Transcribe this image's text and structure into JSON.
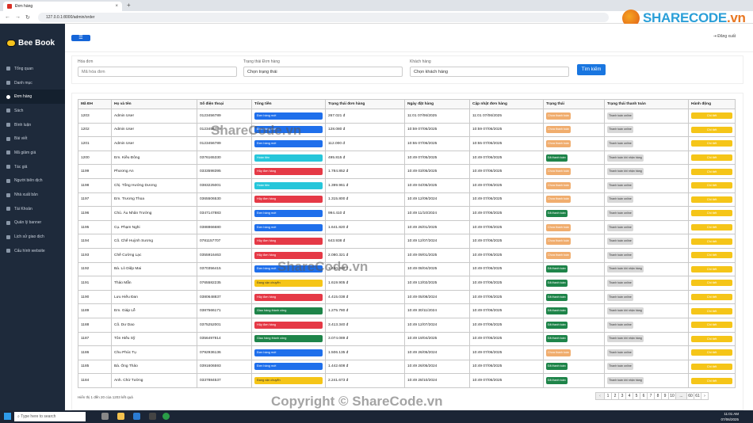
{
  "browser": {
    "tab_title": "Đơn hàng",
    "url": "127.0.0.1:8000/admin/order"
  },
  "watermark": {
    "brand": "SHARECODE",
    "brand_suffix": ".vn",
    "center": "ShareCode.vn",
    "copyright": "Copyright © ShareCode.vn"
  },
  "sidebar": {
    "logo": "Bee Book",
    "items": [
      {
        "label": "Tổng quan",
        "active": false
      },
      {
        "label": "Danh mục",
        "active": false
      },
      {
        "label": "Đơn hàng",
        "active": true
      },
      {
        "label": "Sách",
        "active": false
      },
      {
        "label": "Bình luận",
        "active": false
      },
      {
        "label": "Bài viết",
        "active": false
      },
      {
        "label": "Mã giảm giá",
        "active": false
      },
      {
        "label": "Tác giả",
        "active": false
      },
      {
        "label": "Người biên dịch",
        "active": false
      },
      {
        "label": "Nhà xuất bản",
        "active": false
      },
      {
        "label": "Tài Khoản",
        "active": false
      },
      {
        "label": "Quản lý banner",
        "active": false
      },
      {
        "label": "Lịch sử giao dịch",
        "active": false
      },
      {
        "label": "Cấu hình website",
        "active": false
      }
    ]
  },
  "header": {
    "logout": "Đăng xuất"
  },
  "filters": {
    "invoice_label": "Hóa đơn",
    "invoice_placeholder": "Mã hóa đơn",
    "status_label": "Trạng thái Đơn hàng",
    "status_value": "Chọn trạng thái",
    "customer_label": "Khách hàng",
    "customer_value": "Chọn khách hàng",
    "search_button": "Tìm kiếm"
  },
  "table": {
    "headers": [
      "Mã ĐH",
      "Họ và tên",
      "Số điện thoại",
      "Tổng tiền",
      "Trạng thái đơn hàng",
      "Ngày đặt hàng",
      "Cập nhật đơn hàng",
      "Trạng thái",
      "Trạng thái thanh toán",
      "Hành động"
    ],
    "action_label": "Chi tiết",
    "rows": [
      {
        "id": "1203",
        "name": "Admin User",
        "phone": "0123456789",
        "status": "Đơn hàng mới",
        "status_color": "#1f6feb",
        "total": "267.021 đ",
        "ordered": "11:01 07/06/2025",
        "updated": "11:01 07/06/2025",
        "pay": "Chưa thanh toán",
        "pay_color": "#f0ad6e",
        "ship": "Thanh toán online"
      },
      {
        "id": "1202",
        "name": "Admin User",
        "phone": "0123456789",
        "status": "Đơn hàng mới",
        "status_color": "#1f6feb",
        "total": "128.080 đ",
        "ordered": "10:59 07/06/2025",
        "updated": "10:59 07/06/2025",
        "pay": "Chưa thanh toán",
        "pay_color": "#f0ad6e",
        "ship": "Thanh toán online"
      },
      {
        "id": "1201",
        "name": "Admin User",
        "phone": "0123456789",
        "status": "Đơn hàng mới",
        "status_color": "#1f6feb",
        "total": "112.000 đ",
        "ordered": "10:55 07/06/2025",
        "updated": "10:55 07/06/2025",
        "pay": "Chưa thanh toán",
        "pay_color": "#f0ad6e",
        "ship": "Thanh toán online"
      },
      {
        "id": "1200",
        "name": "Em. Kiều Đông",
        "phone": "0376165330",
        "status": "Hoàn tiền",
        "status_color": "#26c6da",
        "total": "495.815 đ",
        "ordered": "10:49 07/05/2025",
        "updated": "10:49 07/06/2025",
        "pay": "Đã thanh toán",
        "pay_color": "#1e8449",
        "ship": "Thanh toán khi nhận hàng"
      },
      {
        "id": "1199",
        "name": "Phương An",
        "phone": "0333598395",
        "status": "Hủy đơn hàng",
        "status_color": "#e53946",
        "total": "1.784.852 đ",
        "ordered": "10:49 03/05/2025",
        "updated": "10:49 07/06/2025",
        "pay": "Chưa thanh toán",
        "pay_color": "#f0ad6e",
        "ship": "Thanh toán khi nhận hàng"
      },
      {
        "id": "1198",
        "name": "Chị. Tống Hướng Dương",
        "phone": "0383225001",
        "status": "Hoàn tiền",
        "status_color": "#26c6da",
        "total": "1.399.961 đ",
        "ordered": "10:49 04/05/2025",
        "updated": "10:49 07/06/2025",
        "pay": "Chưa thanh toán",
        "pay_color": "#f0ad6e",
        "ship": "Thanh toán online"
      },
      {
        "id": "1197",
        "name": "Em. Trương Thoa",
        "phone": "0365506530",
        "status": "Hủy đơn hàng",
        "status_color": "#e53946",
        "total": "1.315.800 đ",
        "ordered": "10:49 12/09/2024",
        "updated": "10:49 07/06/2025",
        "pay": "Chưa thanh toán",
        "pay_color": "#f0ad6e",
        "ship": "Thanh toán online"
      },
      {
        "id": "1196",
        "name": "Chú. Âu Nhân Trường",
        "phone": "0347147883",
        "status": "Đơn hàng mới",
        "status_color": "#1f6feb",
        "total": "994.410 đ",
        "ordered": "10:49 11/10/2024",
        "updated": "10:49 07/06/2025",
        "pay": "Đã thanh toán",
        "pay_color": "#1e8449",
        "ship": "Thanh toán online"
      },
      {
        "id": "1195",
        "name": "Cụ. Phạm Nghi",
        "phone": "0388866680",
        "status": "Đơn hàng mới",
        "status_color": "#1f6feb",
        "total": "1.641.820 đ",
        "ordered": "10:49 26/01/2025",
        "updated": "10:49 07/06/2025",
        "pay": "Chưa thanh toán",
        "pay_color": "#f0ad6e",
        "ship": "Thanh toán online"
      },
      {
        "id": "1194",
        "name": "Cô. Chế Huỳnh Sương",
        "phone": "0781157707",
        "status": "Hủy đơn hàng",
        "status_color": "#e53946",
        "total": "643.938 đ",
        "ordered": "10:49 12/07/2024",
        "updated": "10:49 07/06/2025",
        "pay": "Chưa thanh toán",
        "pay_color": "#f0ad6e",
        "ship": "Thanh toán online"
      },
      {
        "id": "1193",
        "name": "Chế Cường Lạc",
        "phone": "0355916463",
        "status": "Hủy đơn hàng",
        "status_color": "#e53946",
        "total": "2.080.321 đ",
        "ordered": "10:49 09/01/2025",
        "updated": "10:49 07/06/2025",
        "pay": "Chưa thanh toán",
        "pay_color": "#f0ad6e",
        "ship": "Thanh toán online"
      },
      {
        "id": "1192",
        "name": "Bà. Lò Diệp Mai",
        "phone": "0370356415",
        "status": "Đơn hàng mới",
        "status_color": "#1f6feb",
        "total": "1.450.388 đ",
        "ordered": "10:49 08/04/2025",
        "updated": "10:49 07/06/2025",
        "pay": "Đã thanh toán",
        "pay_color": "#1e8449",
        "ship": "Thanh toán khi nhận hàng"
      },
      {
        "id": "1191",
        "name": "Thảo Mẫn",
        "phone": "0765582235",
        "status": "Đang vận chuyển",
        "status_color": "#f5c518",
        "total": "1.619.905 đ",
        "ordered": "10:49 13/02/2025",
        "updated": "10:49 07/06/2025",
        "pay": "Đã thanh toán",
        "pay_color": "#1e8449",
        "ship": "Thanh toán online"
      },
      {
        "id": "1190",
        "name": "Lưu Hiếu Đan",
        "phone": "0380648837",
        "status": "Hủy đơn hàng",
        "status_color": "#e53946",
        "total": "4.415.038 đ",
        "ordered": "10:49 05/08/2024",
        "updated": "10:49 07/06/2025",
        "pay": "Đã thanh toán",
        "pay_color": "#1e8449",
        "ship": "Thanh toán online"
      },
      {
        "id": "1189",
        "name": "Em. Giáp Lễ",
        "phone": "0387566171",
        "status": "Giao hàng thành công",
        "status_color": "#1e8449",
        "total": "1.275.780 đ",
        "ordered": "10:49 30/11/2024",
        "updated": "10:49 07/06/2025",
        "pay": "Đã thanh toán",
        "pay_color": "#1e8449",
        "ship": "Thanh toán khi nhận hàng"
      },
      {
        "id": "1188",
        "name": "Cô. Dư Dao",
        "phone": "0375252001",
        "status": "Hủy đơn hàng",
        "status_color": "#e53946",
        "total": "3.413.340 đ",
        "ordered": "10:49 12/07/2024",
        "updated": "10:49 07/06/2025",
        "pay": "Đã thanh toán",
        "pay_color": "#1e8449",
        "ship": "Thanh toán online"
      },
      {
        "id": "1187",
        "name": "Tôn Hiếu Sỹ",
        "phone": "0356497814",
        "status": "Giao hàng thành công",
        "status_color": "#1e8449",
        "total": "3.074.089 đ",
        "ordered": "10:49 19/04/2025",
        "updated": "10:49 07/06/2025",
        "pay": "Đã thanh toán",
        "pay_color": "#1e8449",
        "ship": "Thanh toán khi nhận hàng"
      },
      {
        "id": "1186",
        "name": "Chu Phúc Tụ",
        "phone": "0792936136",
        "status": "Đơn hàng mới",
        "status_color": "#1f6feb",
        "total": "1.506.135 đ",
        "ordered": "10:49 26/05/2024",
        "updated": "10:49 07/06/2025",
        "pay": "Chưa thanh toán",
        "pay_color": "#f0ad6e",
        "ship": "Thanh toán online"
      },
      {
        "id": "1185",
        "name": "Bà. Ông Thảo",
        "phone": "0391606593",
        "status": "Đơn hàng mới",
        "status_color": "#1f6feb",
        "total": "1.442.608 đ",
        "ordered": "10:49 26/05/2024",
        "updated": "10:49 07/06/2025",
        "pay": "Đã thanh toán",
        "pay_color": "#1e8449",
        "ship": "Thanh toán online"
      },
      {
        "id": "1184",
        "name": "Anh. Chử Tường",
        "phone": "0337884537",
        "status": "Đang vận chuyển",
        "status_color": "#f5c518",
        "total": "2.241.673 đ",
        "ordered": "10:49 28/10/2024",
        "updated": "10:49 07/06/2025",
        "pay": "Đã thanh toán",
        "pay_color": "#1e8449",
        "ship": "Thanh toán khi nhận hàng"
      }
    ]
  },
  "pagination": {
    "info": "Hiển thị 1 đến 20 của 1203 kết quả",
    "first": "‹",
    "pages": [
      "1",
      "2",
      "3",
      "4",
      "5",
      "6",
      "7",
      "8",
      "9",
      "10",
      "...",
      "60",
      "61"
    ],
    "next": "›"
  },
  "taskbar": {
    "search": "Type here to search",
    "time": "11:01 AM",
    "date": "07/06/2025"
  }
}
